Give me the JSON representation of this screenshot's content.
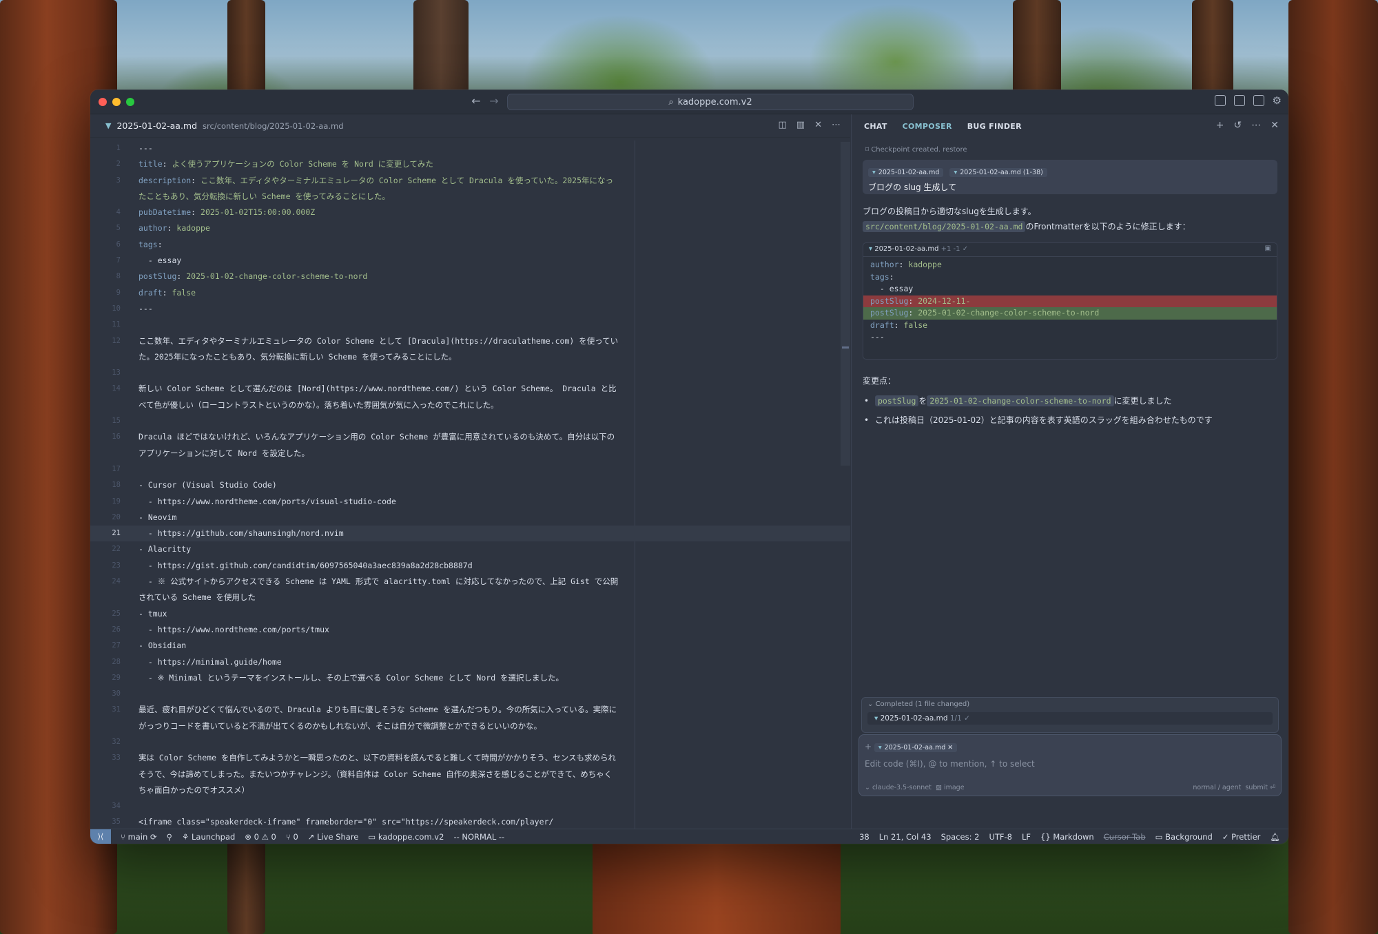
{
  "window": {
    "search_text": "kadoppe.com.v2"
  },
  "editor": {
    "tab_name": "2025-01-02-aa.md",
    "tab_path": "src/content/blog/2025-01-02-aa.md",
    "lines": [
      {
        "n": "1",
        "text": "---"
      },
      {
        "n": "2",
        "key": "title",
        "value": "よく使うアプリケーションの Color Scheme を Nord に変更してみた"
      },
      {
        "n": "3",
        "key": "description",
        "value": "ここ数年、エディタやターミナルエミュレータの Color Scheme として Dracula を使っていた。2025年になっ"
      },
      {
        "n": "",
        "value": "たこともあり、気分転換に新しい Scheme を使ってみることにした。"
      },
      {
        "n": "4",
        "key": "pubDatetime",
        "value": "2025-01-02T15:00:00.000Z"
      },
      {
        "n": "5",
        "key": "author",
        "value": "kadoppe"
      },
      {
        "n": "6",
        "key": "tags",
        "value": ""
      },
      {
        "n": "7",
        "text": "  - essay"
      },
      {
        "n": "8",
        "key": "postSlug",
        "value": "2025-01-02-change-color-scheme-to-nord"
      },
      {
        "n": "9",
        "key": "draft",
        "value": "false"
      },
      {
        "n": "10",
        "text": "---"
      },
      {
        "n": "11",
        "text": ""
      },
      {
        "n": "12",
        "text": "ここ数年、エディタやターミナルエミュレータの Color Scheme として [Dracula](https://draculatheme.com) を使ってい"
      },
      {
        "n": "",
        "text": "た。2025年になったこともあり、気分転換に新しい Scheme を使ってみることにした。"
      },
      {
        "n": "13",
        "text": ""
      },
      {
        "n": "14",
        "text": "新しい Color Scheme として選んだのは [Nord](https://www.nordtheme.com/) という Color Scheme。 Dracula と比"
      },
      {
        "n": "",
        "text": "べて色が優しい（ローコントラストというのかな）。落ち着いた雰囲気が気に入ったのでこれにした。"
      },
      {
        "n": "15",
        "text": ""
      },
      {
        "n": "16",
        "text": "Dracula ほどではないけれど、いろんなアプリケーション用の Color Scheme が豊富に用意されているのも決めて。自分は以下の"
      },
      {
        "n": "",
        "text": "アプリケーションに対して Nord を設定した。"
      },
      {
        "n": "17",
        "text": ""
      },
      {
        "n": "18",
        "text": "- Cursor (Visual Studio Code)"
      },
      {
        "n": "19",
        "text": "  - https://www.nordtheme.com/ports/visual-studio-code"
      },
      {
        "n": "20",
        "text": "- Neovim"
      },
      {
        "n": "21",
        "text": "  - https://github.com/shaunsingh/nord.nvim",
        "current": true
      },
      {
        "n": "22",
        "text": "- Alacritty"
      },
      {
        "n": "23",
        "text": "  - https://gist.github.com/candidtim/6097565040a3aec839a8a2d28cb8887d"
      },
      {
        "n": "24",
        "text": "  - ※ 公式サイトからアクセスできる Scheme は YAML 形式で alacritty.toml に対応してなかったので、上記 Gist で公開"
      },
      {
        "n": "",
        "text": "されている Scheme を使用した"
      },
      {
        "n": "25",
        "text": "- tmux"
      },
      {
        "n": "26",
        "text": "  - https://www.nordtheme.com/ports/tmux"
      },
      {
        "n": "27",
        "text": "- Obsidian"
      },
      {
        "n": "28",
        "text": "  - https://minimal.guide/home"
      },
      {
        "n": "29",
        "text": "  - ※ Minimal というテーマをインストールし、その上で選べる Color Scheme として Nord を選択しました。"
      },
      {
        "n": "30",
        "text": ""
      },
      {
        "n": "31",
        "text": "最近、疲れ目がひどくて悩んでいるので、Dracula よりも目に優しそうな Scheme を選んだつもり。今の所気に入っている。実際に"
      },
      {
        "n": "",
        "text": "がっつりコードを書いていると不満が出てくるのかもしれないが、そこは自分で微調整とかできるといいのかな。"
      },
      {
        "n": "32",
        "text": ""
      },
      {
        "n": "33",
        "text": "実は Color Scheme を自作してみようかと一瞬思ったのと、以下の資料を読んでると難しくて時間がかかりそう、センスも求められ"
      },
      {
        "n": "",
        "text": "そうで、今は諦めてしまった。またいつかチャレンジ。（資料自体は Color Scheme 自作の奥深さを感じることができて、めちゃく"
      },
      {
        "n": "",
        "text": "ちゃ面白かったのでオススメ）"
      },
      {
        "n": "34",
        "text": ""
      },
      {
        "n": "35",
        "text": "<iframe class=\"speakerdeck-iframe\" frameborder=\"0\" src=\"https://speakerdeck.com/player/"
      }
    ]
  },
  "panel": {
    "tabs": [
      "CHAT",
      "COMPOSER",
      "BUG FINDER"
    ],
    "active_tab": "COMPOSER",
    "checkpoint": "Checkpoint created. restore",
    "user_chip_1": "2025-01-02-aa.md",
    "user_chip_2": "2025-01-02-aa.md (1-38)",
    "user_message": "ブログの slug 生成して",
    "resp_line_1": "ブログの投稿日から適切なslugを生成します。",
    "resp_code_path": "src/content/blog/2025-01-02-aa.md",
    "resp_line_2_suffix": "のFrontmatterを以下のように修正します：",
    "diff_file": "2025-01-02-aa.md",
    "diff_meta": "+1 -1 ✓",
    "diff_lines": [
      {
        "type": "ctx",
        "key": "author",
        "value": "kadoppe"
      },
      {
        "type": "ctx",
        "key": "tags",
        "value": ""
      },
      {
        "type": "ctx",
        "text": "  - essay"
      },
      {
        "type": "del",
        "key": "postSlug",
        "value": "2024-12-11-"
      },
      {
        "type": "add",
        "key": "postSlug",
        "value": "2025-01-02-change-color-scheme-to-nord"
      },
      {
        "type": "ctx",
        "key": "draft",
        "value": "false"
      },
      {
        "type": "ctx",
        "text": "---"
      }
    ],
    "changes_title": "変更点：",
    "bullet_1_code_a": "postSlug",
    "bullet_1_mid": "を",
    "bullet_1_code_b": "2025-01-02-change-color-scheme-to-nord",
    "bullet_1_suffix": "に変更しました",
    "bullet_2": "これは投稿日（2025-01-02）と記事の内容を表す英語のスラッグを組み合わせたものです",
    "completed_label": "Completed (1 file changed)",
    "completed_file": "2025-01-02-aa.md",
    "completed_meta": "1/1 ✓",
    "input_chip": "2025-01-02-aa.md",
    "input_placeholder": "Edit code (⌘I), @ to mention, ↑ to select",
    "model": "claude-3.5-sonnet",
    "image_label": "image",
    "mode": "normal / agent",
    "submit": "submit ⏎"
  },
  "statusbar": {
    "branch": "main",
    "launchpad": "Launchpad",
    "errors": "0",
    "warnings": "0",
    "ports": "0",
    "live_share": "Live Share",
    "workspace": "kadoppe.com.v2",
    "vim_mode": "-- NORMAL --",
    "count": "38",
    "position": "Ln 21, Col 43",
    "spaces": "Spaces: 2",
    "encoding": "UTF-8",
    "eol": "LF",
    "language": "Markdown",
    "cursor_tab": "Cursor Tab",
    "background": "Background",
    "prettier": "Prettier"
  }
}
